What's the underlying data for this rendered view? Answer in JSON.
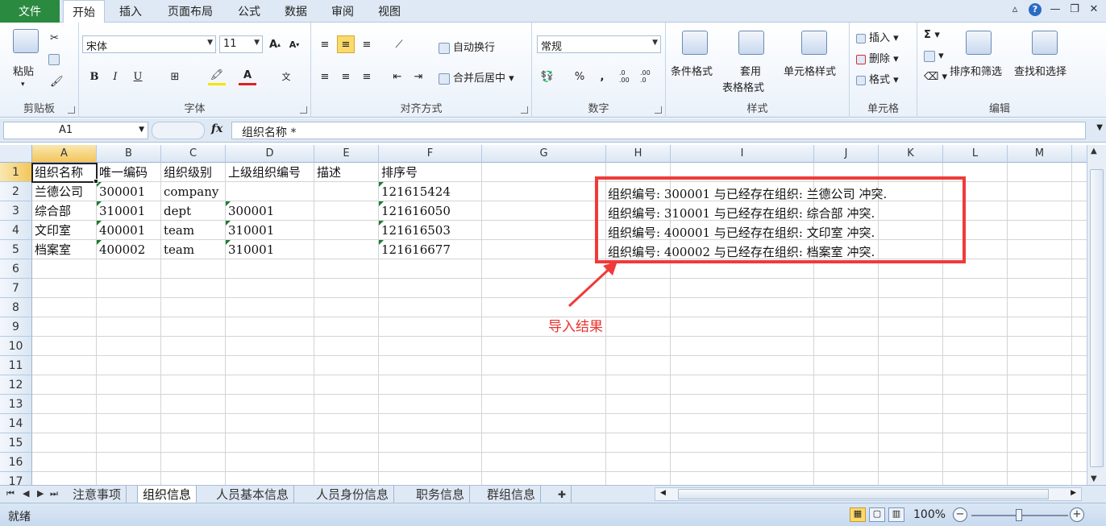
{
  "menu": {
    "file": "文件",
    "tabs": [
      "开始",
      "插入",
      "页面布局",
      "公式",
      "数据",
      "审阅",
      "视图"
    ],
    "active_index": 0
  },
  "ribbon": {
    "clipboard": {
      "paste": "粘贴",
      "label": "剪贴板"
    },
    "font": {
      "name": "宋体",
      "size": "11",
      "bold": "B",
      "italic": "I",
      "underline": "U",
      "label": "字体"
    },
    "alignment": {
      "wrap": "自动换行",
      "merge": "合并后居中",
      "label": "对齐方式"
    },
    "number": {
      "format": "常规",
      "percent": "%",
      "comma": ",",
      "inc_decimal": ".0 .00",
      "dec_decimal": ".00 .0",
      "label": "数字"
    },
    "styles": {
      "cond": "条件格式",
      "table_1": "套用",
      "table_2": "表格格式",
      "cell_styles": "单元格样式",
      "label": "样式"
    },
    "cells": {
      "insert": "插入",
      "delete": "删除",
      "format": "格式",
      "label": "单元格"
    },
    "editing": {
      "sigma": "Σ",
      "sort": "排序和筛选",
      "find": "查找和选择",
      "label": "编辑"
    }
  },
  "formula_bar": {
    "name_box": "A1",
    "fx": "fx",
    "content": "组织名称 *"
  },
  "columns": [
    "A",
    "B",
    "C",
    "D",
    "E",
    "F",
    "G",
    "H",
    "I",
    "J",
    "K",
    "L",
    "M"
  ],
  "rows": [
    "1",
    "2",
    "3",
    "4",
    "5",
    "6",
    "7",
    "8",
    "9",
    "10",
    "11",
    "12",
    "13",
    "14",
    "15",
    "16",
    "17"
  ],
  "sheet": {
    "header": [
      "组织名称",
      "唯一编码",
      "组织级别",
      "上级组织编号",
      "描述",
      "排序号"
    ],
    "data": [
      [
        "兰德公司",
        "300001",
        "company",
        "",
        "",
        "121615424"
      ],
      [
        "综合部",
        "310001",
        "dept",
        "300001",
        "",
        "121616050"
      ],
      [
        "文印室",
        "400001",
        "team",
        "310001",
        "",
        "121616503"
      ],
      [
        "档案室",
        "400002",
        "team",
        "310001",
        "",
        "121616677"
      ]
    ],
    "results": [
      "组织编号: 300001 与已经存在组织: 兰德公司 冲突.",
      "组织编号: 310001 与已经存在组织: 综合部 冲突.",
      "组织编号: 400001 与已经存在组织: 文印室 冲突.",
      "组织编号: 400002 与已经存在组织: 档案室 冲突."
    ]
  },
  "annotation": {
    "label": "导入结果",
    "color": "#f03a3a"
  },
  "sheet_tabs": [
    "注意事项",
    "组织信息",
    "人员基本信息",
    "人员身份信息",
    "职务信息",
    "群组信息"
  ],
  "active_sheet_index": 1,
  "status": {
    "text": "就绪",
    "zoom": "100%"
  },
  "colors": {
    "file_tab": "#2a8a3f",
    "ribbon_bg": "#dfe9f5",
    "selection": "#f3c65a"
  }
}
